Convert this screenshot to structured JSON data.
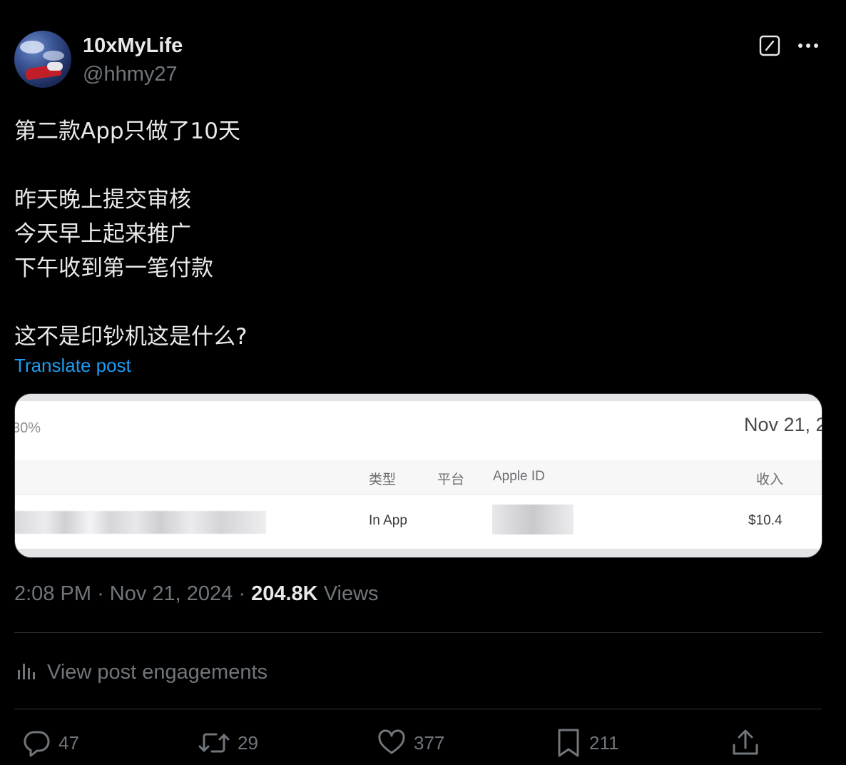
{
  "author": {
    "display_name": "10xMyLife",
    "handle": "@hhmy27"
  },
  "post": {
    "lines": [
      "第二款App只做了10天",
      "",
      "昨天晚上提交审核",
      "今天早上起来推广",
      "下午收到第一笔付款",
      "",
      "这不是印钞机这是什么?"
    ],
    "translate_label": "Translate post"
  },
  "image": {
    "percent_fragment": "30%",
    "date_fragment": "Nov 21, 2",
    "columns": [
      "类型",
      "平台",
      "Apple ID",
      "收入"
    ],
    "row": {
      "type": "In App",
      "revenue": "$10.4"
    }
  },
  "meta": {
    "time": "2:08 PM",
    "separator": "·",
    "date": "Nov 21, 2024",
    "views_count": "204.8K",
    "views_label": "Views"
  },
  "engagements_label": "View post engagements",
  "actions": {
    "replies": "47",
    "reposts": "29",
    "likes": "377",
    "bookmarks": "211"
  },
  "icons": [
    "grok-icon",
    "more-icon",
    "analytics-icon",
    "reply-icon",
    "repost-icon",
    "like-icon",
    "bookmark-icon",
    "share-icon"
  ],
  "colors": {
    "background": "#000000",
    "primary_text": "#e7e9ea",
    "secondary_text": "#71767b",
    "link": "#1d9bf0",
    "divider": "#2f3336"
  }
}
